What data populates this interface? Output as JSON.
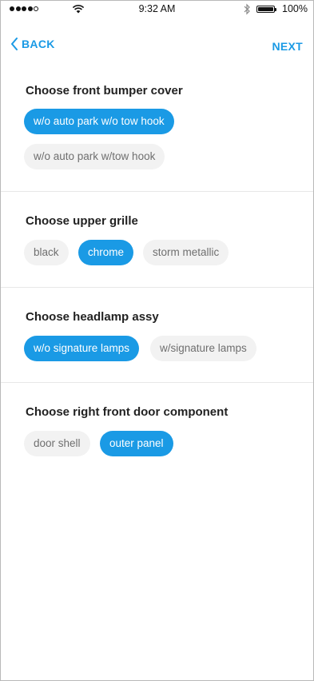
{
  "status_bar": {
    "time": "9:32 AM",
    "battery": "100%",
    "icons": [
      "signal-dots-icon",
      "wifi-icon",
      "bluetooth-icon",
      "battery-icon"
    ]
  },
  "nav": {
    "back_label": "BACK",
    "next_label": "NEXT"
  },
  "colors": {
    "accent": "#1a9ae5",
    "chip_bg": "#f2f2f2",
    "chip_text": "#6f6f6f"
  },
  "sections": [
    {
      "title": "Choose front bumper cover",
      "options": [
        {
          "label": "w/o auto park w/o tow hook",
          "selected": true
        },
        {
          "label": "w/o auto park w/tow hook",
          "selected": false
        }
      ]
    },
    {
      "title": "Choose upper grille",
      "options": [
        {
          "label": "black",
          "selected": false
        },
        {
          "label": "chrome",
          "selected": true
        },
        {
          "label": "storm metallic",
          "selected": false
        }
      ]
    },
    {
      "title": "Choose headlamp assy",
      "options": [
        {
          "label": "w/o signature lamps",
          "selected": true
        },
        {
          "label": "w/signature lamps",
          "selected": false
        }
      ]
    },
    {
      "title": "Choose right front door component",
      "options": [
        {
          "label": "door shell",
          "selected": false
        },
        {
          "label": "outer panel",
          "selected": true
        }
      ]
    }
  ]
}
